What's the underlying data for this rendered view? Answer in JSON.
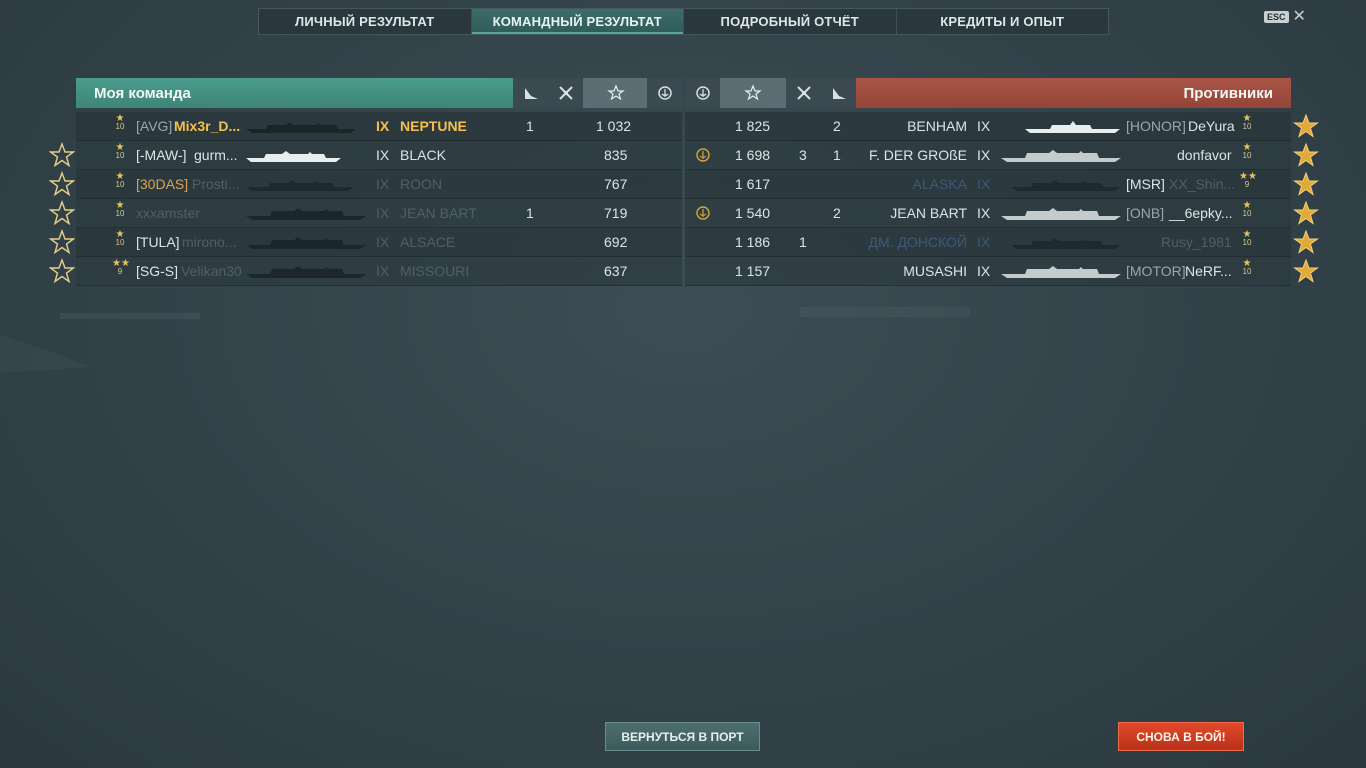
{
  "tabs": [
    {
      "label": "ЛИЧНЫЙ РЕЗУЛЬТАТ"
    },
    {
      "label": "КОМАНДНЫЙ РЕЗУЛЬТАТ",
      "active": true
    },
    {
      "label": "ПОДРОБНЫЙ ОТЧЁТ"
    },
    {
      "label": "КРЕДИТЫ И ОПЫТ"
    }
  ],
  "esc": {
    "key": "ESC",
    "close": "✕"
  },
  "my_team": {
    "title": "Моя команда",
    "header_icons": [
      "torpedo-kill-icon",
      "plane-kill-icon",
      "xp-star-icon",
      "base-capture-icon"
    ],
    "rows": [
      {
        "tier": "10",
        "tier_stars": "★",
        "clan": "[AVG]",
        "player": "Mix3r_D...",
        "ship_tier": "IX",
        "ship": "NEPTUNE",
        "kills": "1",
        "xp": "1 032",
        "highlight": true,
        "star": false
      },
      {
        "tier": "10",
        "tier_stars": "★",
        "clan": "[-MAW-]",
        "player": "gurm...",
        "ship_tier": "IX",
        "ship": "BLACK",
        "kills": "",
        "xp": "835",
        "star": true
      },
      {
        "tier": "10",
        "tier_stars": "★",
        "clan": "[30DAS]",
        "player": "Prosti...",
        "ship_tier": "IX",
        "ship": "ROON",
        "kills": "",
        "xp": "767",
        "star": true
      },
      {
        "tier": "10",
        "tier_stars": "★",
        "clan": "",
        "player": "xxxamster",
        "ship_tier": "IX",
        "ship": "JEAN BART",
        "kills": "1",
        "xp": "719",
        "star": true
      },
      {
        "tier": "10",
        "tier_stars": "★",
        "clan": "[TULA]",
        "player": "mirono...",
        "ship_tier": "IX",
        "ship": "ALSACE",
        "kills": "",
        "xp": "692",
        "star": true
      },
      {
        "tier": "9",
        "tier_stars": "★★",
        "clan": "[SG-S]",
        "player": "Velikan30",
        "ship_tier": "IX",
        "ship": "MISSOURI",
        "kills": "",
        "xp": "637",
        "star": true
      }
    ]
  },
  "enemy_team": {
    "title": "Противники",
    "header_icons": [
      "base-capture-icon",
      "xp-star-icon",
      "plane-kill-icon",
      "torpedo-kill-icon"
    ],
    "rows": [
      {
        "capture": false,
        "xp": "1 825",
        "planes": "",
        "kills": "2",
        "ship": "BENHAM",
        "ship_tier": "IX",
        "clan": "[HONOR]",
        "player": "DeYura",
        "tier": "10",
        "tier_stars": "★"
      },
      {
        "capture": true,
        "xp": "1 698",
        "planes": "3",
        "kills": "1",
        "ship": "F. DER GROßE",
        "ship_tier": "IX",
        "clan": "",
        "player": "donfavor",
        "tier": "10",
        "tier_stars": "★"
      },
      {
        "capture": false,
        "xp": "1 617",
        "planes": "",
        "kills": "",
        "ship": "ALASKA",
        "ship_tier": "IX",
        "clan": "[MSR]",
        "player": "XX_Shin...",
        "tier": "9",
        "tier_stars": "★★"
      },
      {
        "capture": true,
        "xp": "1 540",
        "planes": "",
        "kills": "2",
        "ship": "JEAN BART",
        "ship_tier": "IX",
        "clan": "[ONB]",
        "player": "__6epky...",
        "tier": "10",
        "tier_stars": "★"
      },
      {
        "capture": false,
        "xp": "1 186",
        "planes": "1",
        "kills": "",
        "ship": "ДМ. ДОНСКОЙ",
        "ship_tier": "IX",
        "clan": "",
        "player": "Rusy_1981",
        "tier": "10",
        "tier_stars": "★"
      },
      {
        "capture": false,
        "xp": "1 157",
        "planes": "",
        "kills": "",
        "ship": "MUSASHI",
        "ship_tier": "IX",
        "clan": "[MOTOR]",
        "player": "NeRF...",
        "tier": "10",
        "tier_stars": "★"
      }
    ]
  },
  "buttons": {
    "port": "ВЕРНУТЬСЯ В ПОРТ",
    "battle": "СНОВА В БОЙ!"
  },
  "colors": {
    "my_team": "#4a9c8c",
    "enemy_team": "#a95546",
    "battle_button": "#d23e22",
    "highlight": "#f2c14e"
  }
}
